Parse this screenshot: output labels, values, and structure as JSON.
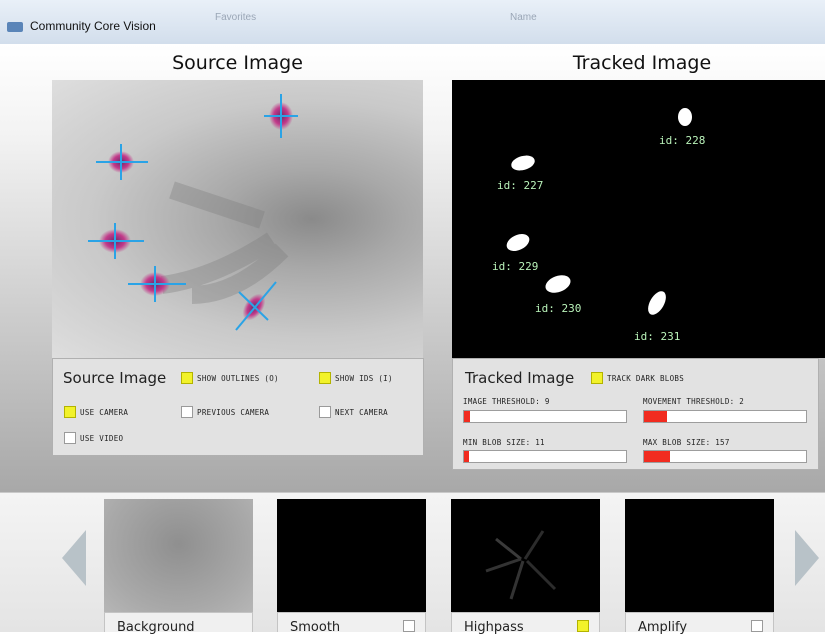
{
  "window": {
    "title": "Community Core Vision",
    "ghost_text_1": "Favorites",
    "ghost_text_2": "Name"
  },
  "source": {
    "heading": "Source Image",
    "panel_title": "Source Image",
    "show_outlines": {
      "label": "SHOW OUTLINES (O)",
      "checked": true
    },
    "show_ids": {
      "label": "SHOW IDS (I)",
      "checked": true
    },
    "use_camera": {
      "label": "USE CAMERA",
      "checked": true
    },
    "previous_camera": {
      "label": "PREVIOUS CAMERA",
      "checked": false
    },
    "next_camera": {
      "label": "NEXT CAMERA",
      "checked": false
    },
    "use_video": {
      "label": "USE VIDEO",
      "checked": false
    }
  },
  "tracked": {
    "heading": "Tracked Image",
    "panel_title": "Tracked Image",
    "track_dark_blobs": {
      "label": "TRACK DARK BLOBS",
      "checked": true
    },
    "blobs": [
      {
        "id": "id: 228"
      },
      {
        "id": "id: 227"
      },
      {
        "id": "id: 229"
      },
      {
        "id": "id: 230"
      },
      {
        "id": "id: 231"
      }
    ],
    "sliders": [
      {
        "label": "IMAGE THRESHOLD: 9",
        "fraction": 0.035
      },
      {
        "label": "MOVEMENT THRESHOLD: 2",
        "fraction": 0.14
      },
      {
        "label": "MIN BLOB SIZE: 11",
        "fraction": 0.03
      },
      {
        "label": "MAX BLOB SIZE: 157",
        "fraction": 0.16
      }
    ]
  },
  "filters": [
    {
      "name": "Background",
      "has_checkbox": false,
      "checked": false
    },
    {
      "name": "Smooth",
      "has_checkbox": true,
      "checked": false
    },
    {
      "name": "Highpass",
      "has_checkbox": true,
      "checked": true
    },
    {
      "name": "Amplify",
      "has_checkbox": true,
      "checked": false
    }
  ],
  "colors": {
    "accent_checkbox": "#f2f22a",
    "slider_fill": "#f12b1f",
    "crosshair": "#2aa3e6",
    "blob_label": "#b9f2b9"
  }
}
